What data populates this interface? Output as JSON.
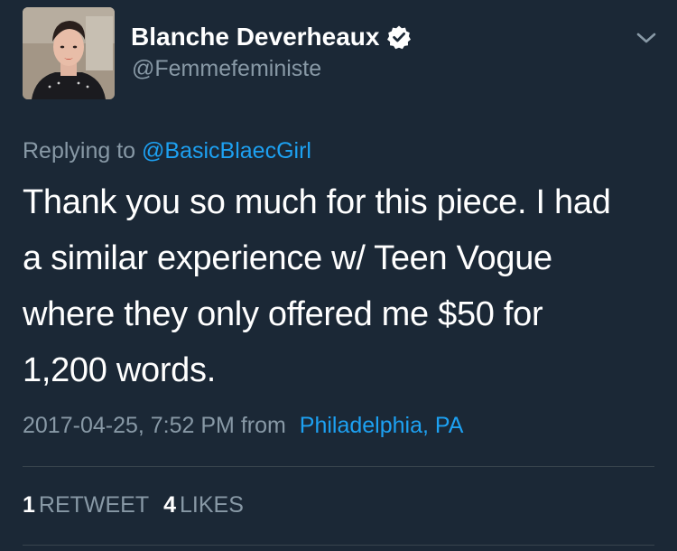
{
  "author": {
    "display_name": "Blanche Deverheaux",
    "handle": "@Femmefeministe",
    "verified": true
  },
  "reply": {
    "prefix": "Replying to",
    "mention": "@BasicBlaecGirl"
  },
  "tweet": {
    "text": "Thank you so much for this piece. I had\na similar experience w/ Teen Vogue\nwhere they only offered me $50 for\n1,200 words."
  },
  "meta": {
    "timestamp": "2017-04-25, 7:52 PM from",
    "location": "Philadelphia, PA"
  },
  "stats": {
    "retweets_count": "1",
    "retweets_label": "RETWEET",
    "likes_count": "4",
    "likes_label": "LIKES"
  },
  "colors": {
    "background": "#1b2836",
    "text_primary": "#ffffff",
    "text_secondary": "#8899a6",
    "link": "#1da1f2",
    "divider": "#38444d"
  },
  "icons": {
    "verified": "verified-badge-icon",
    "menu": "chevron-down-icon"
  }
}
